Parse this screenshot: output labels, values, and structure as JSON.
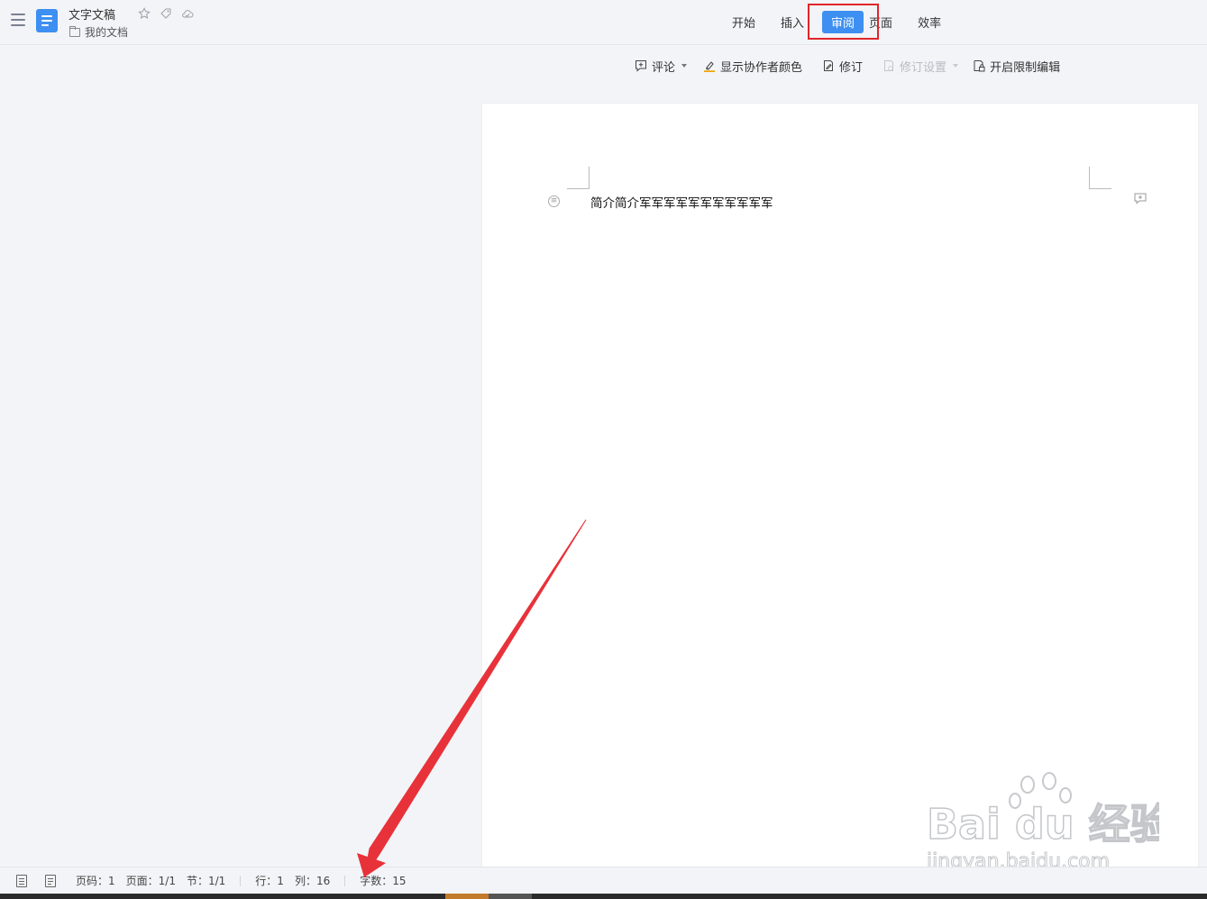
{
  "header": {
    "doc_title": "文字文稿",
    "folder": "我的文档",
    "tabs": [
      {
        "label": "开始"
      },
      {
        "label": "插入"
      },
      {
        "label": "审阅"
      },
      {
        "label": "页面"
      },
      {
        "label": "效率"
      }
    ],
    "active_tab": "审阅"
  },
  "toolbar": {
    "comment": "评论",
    "show_collab_color": "显示协作者颜色",
    "revise": "修订",
    "revise_settings": "修订设置",
    "restrict_edit": "开启限制编辑"
  },
  "document": {
    "text": "简介简介军军军军军军军军军军军"
  },
  "statusbar": {
    "page_num": "页码：1",
    "pages": "页面：1/1",
    "section": "节：1/1",
    "row": "行：1",
    "col": "列：16",
    "word_count": "字数：15"
  },
  "watermark": {
    "brand": "Bai du 经验",
    "url": "jingyan.baidu.com"
  },
  "colors": {
    "accent": "#3d8ff2",
    "highlight": "#e0262b",
    "arrow": "#e8323a"
  }
}
